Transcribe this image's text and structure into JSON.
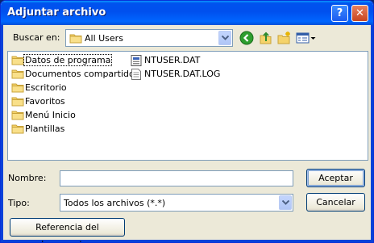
{
  "window": {
    "title": "Adjuntar archivo"
  },
  "titlebar": {
    "help_label": "?",
    "close_label": "✕"
  },
  "lookin": {
    "label": "Buscar en:",
    "value": "All Users"
  },
  "toolbar": {
    "icons": [
      "back-icon",
      "up-folder-icon",
      "new-folder-icon",
      "view-menu-icon"
    ]
  },
  "files": {
    "folders": [
      "Datos de programa",
      "Documentos compartidos",
      "Escritorio",
      "Favoritos",
      "Menú Inicio",
      "Plantillas"
    ],
    "documents": [
      "NTUSER.DAT",
      "NTUSER.DAT.LOG"
    ],
    "selected": "Datos de programa"
  },
  "form": {
    "name_label": "Nombre:",
    "name_value": "",
    "type_label": "Tipo:",
    "type_value": "Todos los archivos (*.*)"
  },
  "buttons": {
    "accept": "Aceptar",
    "cancel": "Cancelar",
    "reference": "Referencia del documento..."
  },
  "colors": {
    "titlebar": "#0053ee",
    "dialog_bg": "#ece9d8",
    "field_border": "#7f9db9",
    "folder": "#f5d36a"
  }
}
